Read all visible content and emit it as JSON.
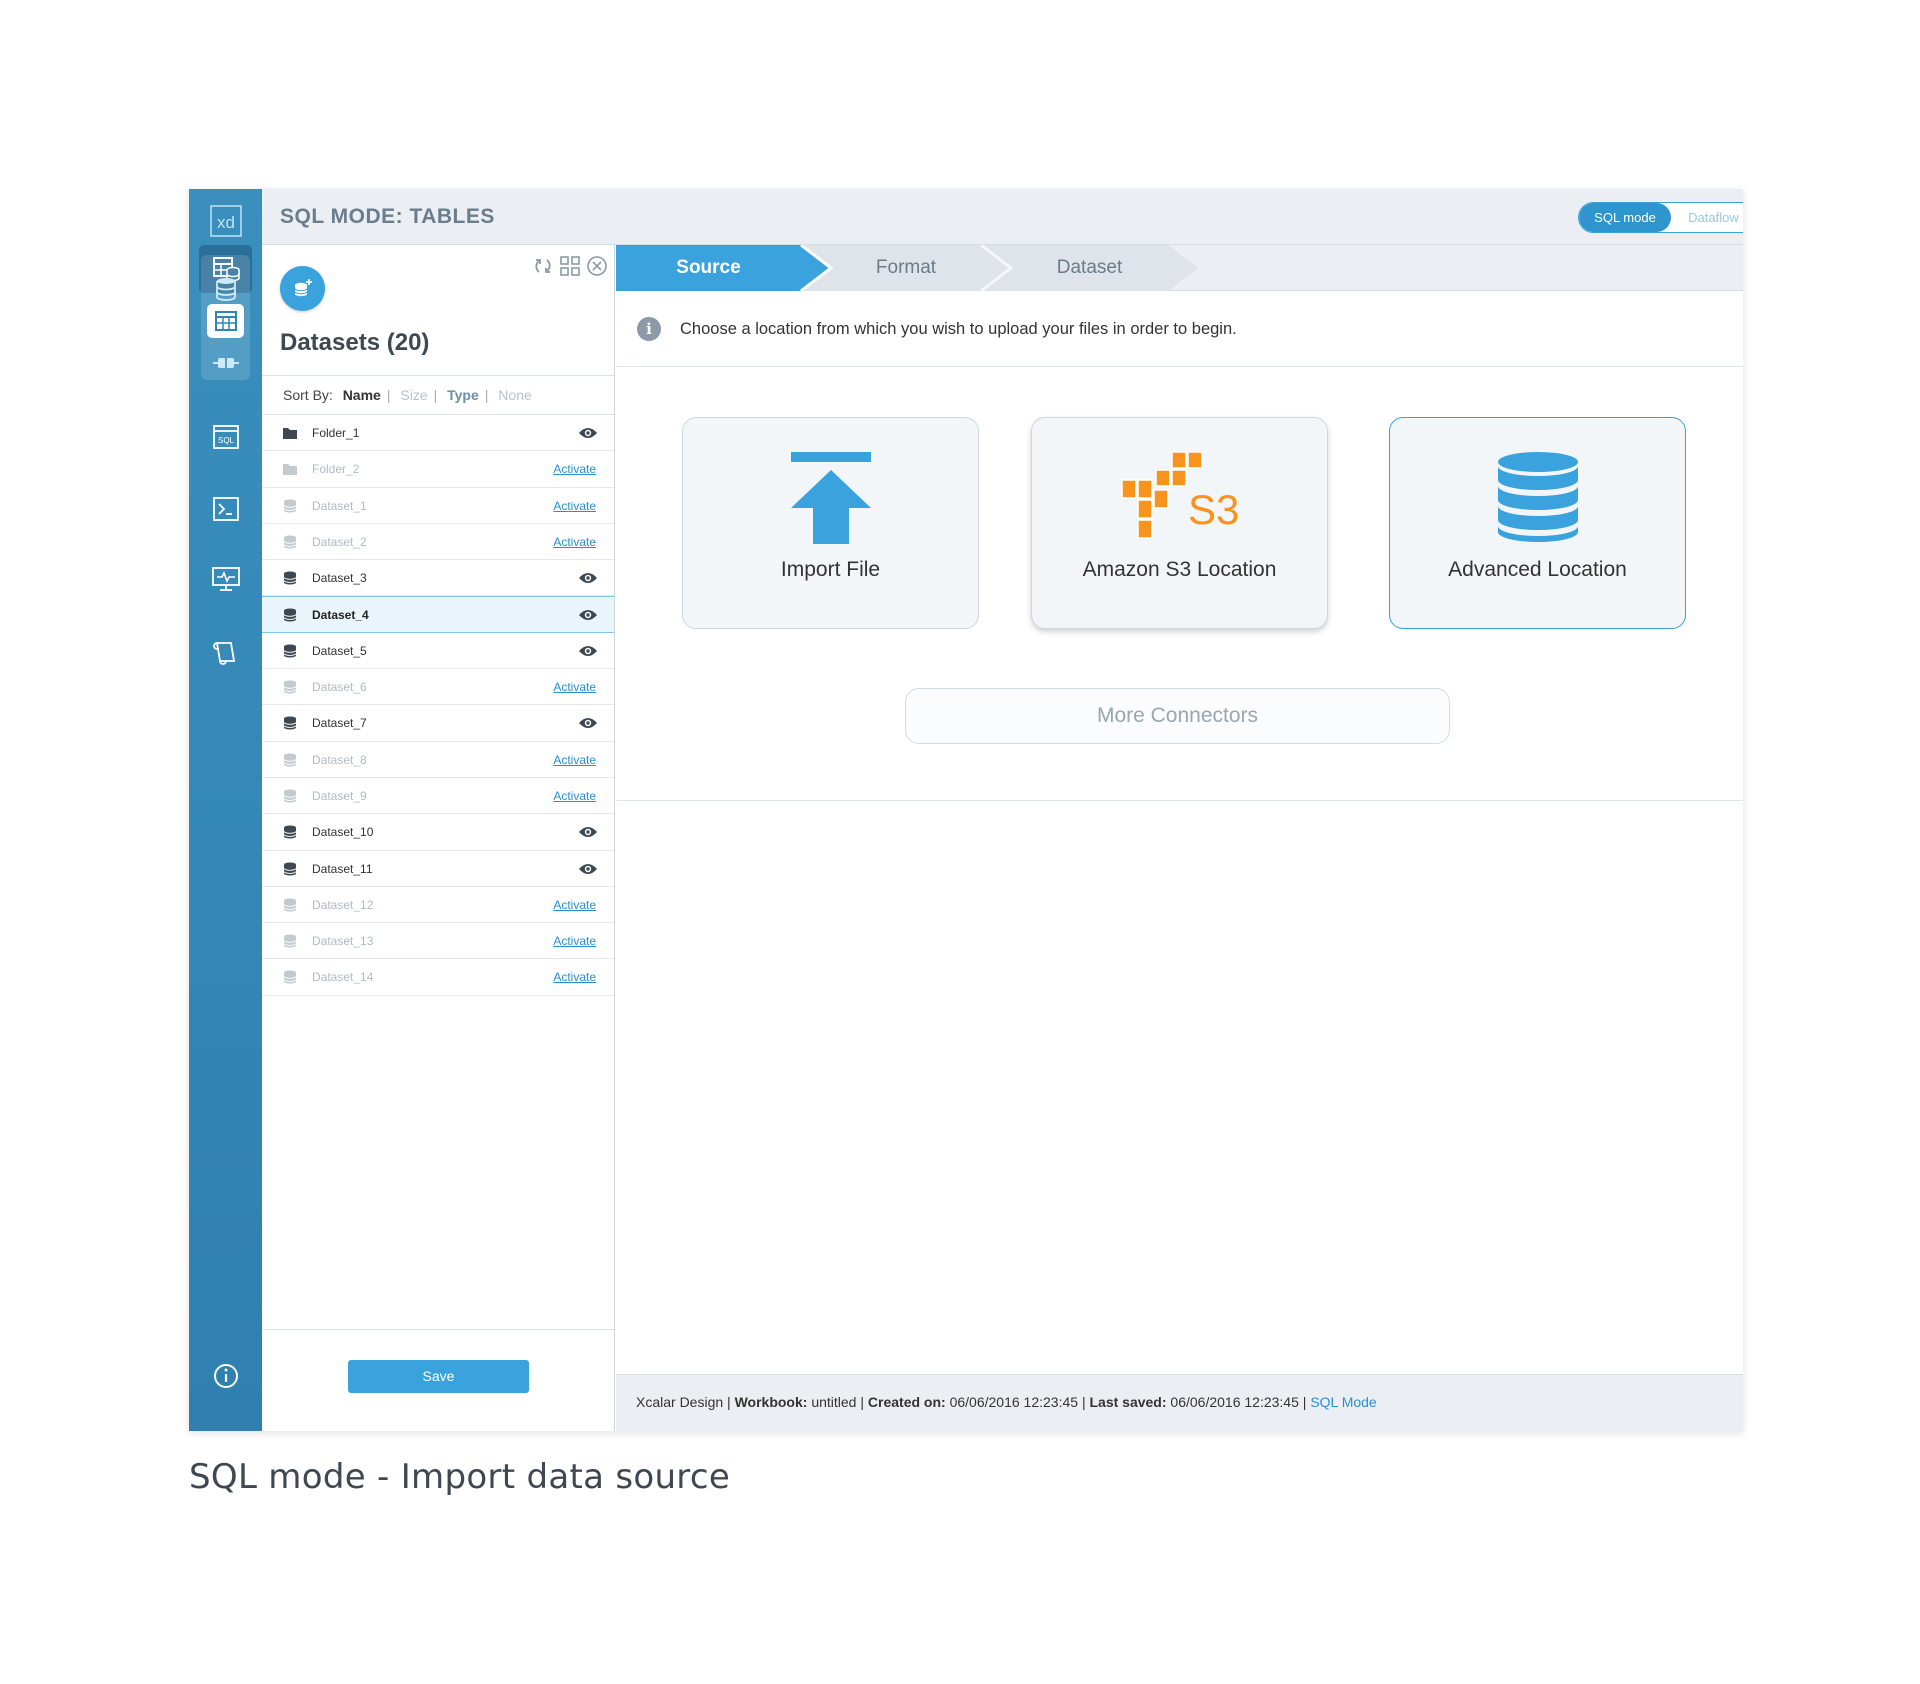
{
  "app": {
    "logo": "xd",
    "page_title": "SQL MODE: TABLES",
    "mode_toggle": {
      "active": "SQL mode",
      "inactive": "Dataflow mode"
    },
    "colors": {
      "accent": "#3aa3de",
      "rail": "#3488b8",
      "s3_orange": "#f7941d",
      "link": "#2a8fcf"
    }
  },
  "rail": {
    "icons": [
      "tables-icon",
      "datasets-icon",
      "table-grid-icon",
      "connector-icon",
      "sql-icon",
      "terminal-icon",
      "monitor-icon",
      "scroll-icon",
      "info-icon"
    ],
    "sql_label": "SQL"
  },
  "panel": {
    "title": "Datasets (20)",
    "tools": [
      "refresh-icon",
      "grid-view-icon",
      "close-icon"
    ],
    "sort": {
      "label": "Sort By:",
      "options": [
        "Name",
        "Size",
        "Type",
        "None"
      ],
      "selected": "Name"
    },
    "activate_label": "Activate",
    "items": [
      {
        "name": "Folder_1",
        "kind": "folder",
        "state": "active"
      },
      {
        "name": "Folder_2",
        "kind": "folder",
        "state": "inactive"
      },
      {
        "name": "Dataset_1",
        "kind": "dataset",
        "state": "inactive"
      },
      {
        "name": "Dataset_2",
        "kind": "dataset",
        "state": "inactive"
      },
      {
        "name": "Dataset_3",
        "kind": "dataset",
        "state": "active"
      },
      {
        "name": "Dataset_4",
        "kind": "dataset",
        "state": "active",
        "selected": true
      },
      {
        "name": "Dataset_5",
        "kind": "dataset",
        "state": "active"
      },
      {
        "name": "Dataset_6",
        "kind": "dataset",
        "state": "inactive"
      },
      {
        "name": "Dataset_7",
        "kind": "dataset",
        "state": "active"
      },
      {
        "name": "Dataset_8",
        "kind": "dataset",
        "state": "inactive"
      },
      {
        "name": "Dataset_9",
        "kind": "dataset",
        "state": "inactive"
      },
      {
        "name": "Dataset_10",
        "kind": "dataset",
        "state": "active"
      },
      {
        "name": "Dataset_11",
        "kind": "dataset",
        "state": "active"
      },
      {
        "name": "Dataset_12",
        "kind": "dataset",
        "state": "inactive"
      },
      {
        "name": "Dataset_13",
        "kind": "dataset",
        "state": "inactive"
      },
      {
        "name": "Dataset_14",
        "kind": "dataset",
        "state": "inactive"
      }
    ],
    "save_label": "Save"
  },
  "steps": {
    "items": [
      "Source",
      "Format",
      "Dataset"
    ],
    "active": "Source"
  },
  "main": {
    "info_icon": "i",
    "info_text": "Choose a location from which you wish to upload your files in order to begin.",
    "cards": {
      "import": "Import File",
      "s3": "Amazon S3 Location",
      "s3_badge": "S3",
      "advanced": "Advanced Location"
    },
    "more_label": "More Connectors"
  },
  "status": {
    "app": "Xcalar Design",
    "sep": "|",
    "workbook_label": "Workbook:",
    "workbook": "untitled",
    "created_label": "Created on:",
    "created": "06/06/2016 12:23:45",
    "saved_label": "Last saved:",
    "saved": "06/06/2016 12:23:45",
    "mode": "SQL Mode"
  },
  "caption": "SQL mode - Import data source"
}
